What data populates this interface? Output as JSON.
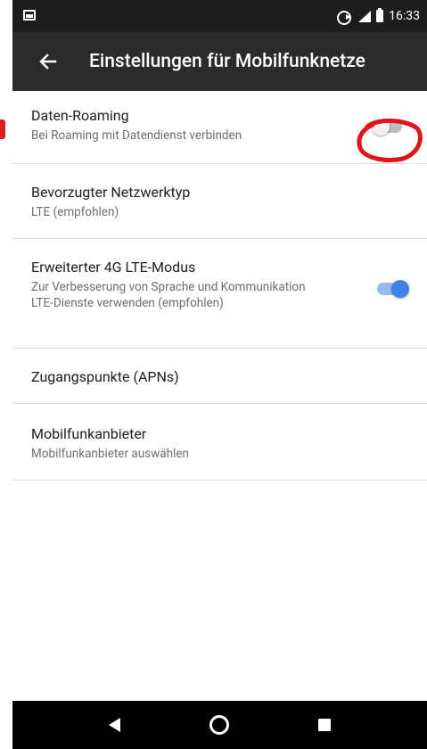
{
  "status_bar": {
    "time": "16:33",
    "icons": [
      "image-icon",
      "sync-icon",
      "signal-icon",
      "battery-icon"
    ]
  },
  "app_bar": {
    "back_icon": "arrow-left-icon",
    "title": "Einstellungen für Mobilfunknetze"
  },
  "settings": {
    "items": [
      {
        "title": "Daten-Roaming",
        "subtitle": "Bei Roaming mit Datendienst verbinden",
        "switch": "off"
      },
      {
        "title": "Bevorzugter Netzwerktyp",
        "subtitle": "LTE (empfohlen)"
      },
      {
        "title": "Erweiterter 4G LTE-Modus",
        "subtitle": "Zur Verbesserung von Sprache und Kommunikation LTE-Dienste verwenden (empfohlen)",
        "switch": "on"
      },
      {
        "title": "Zugangspunkte (APNs)"
      },
      {
        "title": "Mobilfunkanbieter",
        "subtitle": "Mobilfunkanbieter auswählen"
      }
    ]
  },
  "colors": {
    "accent": "#3f82ec",
    "annotation": "#e0141b",
    "app_bar": "#2b2b2b",
    "status_bar": "#1d1d1d"
  },
  "nav_bar": {
    "icons": [
      "back-triangle-icon",
      "home-circle-icon",
      "recents-square-icon"
    ]
  }
}
